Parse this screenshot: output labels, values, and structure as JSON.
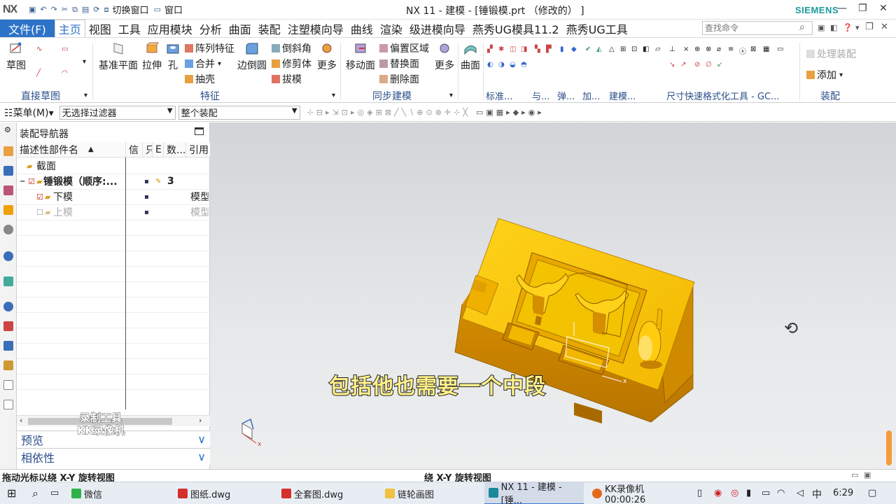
{
  "titlebar": {
    "logo": "NX",
    "switch_window": "切换窗口",
    "window_menu": "窗口",
    "title": "NX 11 - 建模 - [锤锻模.prt （修改的） ]",
    "brand": "SIEMENS",
    "minimize": "—",
    "maximize": "❐",
    "close": "✕"
  },
  "menubar": {
    "file_tab": "文件(F)",
    "tabs": [
      "主页",
      "视图",
      "工具",
      "应用模块",
      "分析",
      "曲面",
      "装配",
      "注塑模向导",
      "曲线",
      "渲染",
      "级进模向导",
      "燕秀UG模具11.2",
      "燕秀UG工具"
    ],
    "active_tab": "主页",
    "search_placeholder": "查找命令"
  },
  "ribbon": {
    "sketch": "草图",
    "group_direct_sketch": "直接草图",
    "datum_plane": "基准平面",
    "extrude": "拉伸",
    "hole": "孔",
    "pattern_feature": "阵列特征",
    "unite": "合并",
    "shell": "抽壳",
    "edge_blend": "边倒圆",
    "chamfer": "倒斜角",
    "trim_body": "修剪体",
    "draft": "拔模",
    "more1": "更多",
    "group_feature": "特征",
    "move_face": "移动面",
    "offset_region": "偏置区域",
    "replace_face": "替换面",
    "delete_face": "删除面",
    "more2": "更多",
    "group_sync": "同步建模",
    "surface": "曲面",
    "group_standard": "标准...",
    "group_small1": "与...",
    "group_small2": "弹...",
    "group_small3": "加...",
    "group_model": "建模...",
    "group_dim": "尺寸快速格式化工具 - GC...",
    "process_assembly": "处理装配",
    "add": "添加",
    "group_assembly": "装配"
  },
  "toolbar2": {
    "menu": "菜单(M)",
    "filter": "无选择过滤器",
    "scope": "整个装配"
  },
  "navigator": {
    "title": "装配导航器",
    "columns": [
      "描述性部件名",
      "信",
      "只",
      "E",
      "数...",
      "引用"
    ],
    "rows": [
      {
        "name": "截面",
        "count": "",
        "ref": ""
      },
      {
        "name": "锤锻模（顺序:...",
        "count": "3",
        "ref": ""
      },
      {
        "name": "下模",
        "count": "",
        "ref": "模型"
      },
      {
        "name": "上模",
        "count": "",
        "ref": "模型"
      }
    ],
    "preview": "预览",
    "dependency": "相依性"
  },
  "viewport": {
    "subtitle": "包括他也需要一个中段",
    "watermark_line1": "录制工具",
    "watermark_line2": "KK录像机",
    "axis_x": "x",
    "axis_x2": "x"
  },
  "statusbar": {
    "left": "拖动光标以绕 X-Y 旋转视图",
    "center": "绕 X-Y 旋转视图"
  },
  "taskbar": {
    "items": [
      "微信",
      "图纸.dwg",
      "全套图.dwg",
      "链轮画图",
      "NX 11 - 建模 - [锤...",
      "KK录像机 00:00:26"
    ],
    "ime": "中",
    "time": "6:29"
  },
  "colors": {
    "accent": "#2c73c8",
    "part": "#f2b800",
    "brand": "#1a9a9a"
  }
}
